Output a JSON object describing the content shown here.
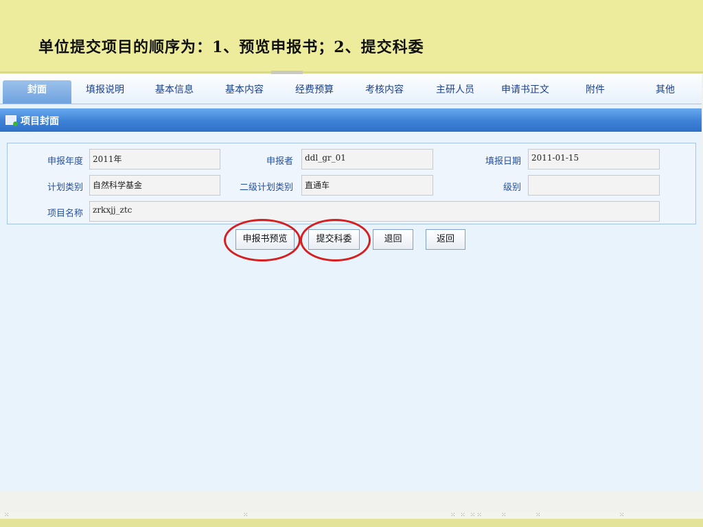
{
  "slide": {
    "title": "单位提交项目的顺序为：1、预览申报书；2、提交科委"
  },
  "tabs": [
    {
      "label": "封面",
      "active": true
    },
    {
      "label": "填报说明",
      "active": false
    },
    {
      "label": "基本信息",
      "active": false
    },
    {
      "label": "基本内容",
      "active": false
    },
    {
      "label": "经费预算",
      "active": false
    },
    {
      "label": "考核内容",
      "active": false
    },
    {
      "label": "主研人员",
      "active": false
    },
    {
      "label": "申请书正文",
      "active": false
    },
    {
      "label": "附件",
      "active": false
    },
    {
      "label": "其他",
      "active": false
    }
  ],
  "section": {
    "icon": "form-icon",
    "title": "项目封面"
  },
  "form": {
    "year": {
      "label": "申报年度",
      "value": "2011年"
    },
    "applicant": {
      "label": "申报者",
      "value": "ddl_gr_01"
    },
    "date": {
      "label": "填报日期",
      "value": "2011-01-15"
    },
    "plan_type": {
      "label": "计划类别",
      "value": "自然科学基金"
    },
    "sub_plan_type": {
      "label": "二级计划类别",
      "value": "直通车"
    },
    "level": {
      "label": "级别",
      "value": ""
    },
    "project_name": {
      "label": "项目名称",
      "value": "zrkxjj_ztc"
    }
  },
  "buttons": {
    "preview": "申报书预览",
    "submit": "提交科委",
    "return_back": "退回",
    "go_back": "返回"
  },
  "annotations": {
    "highlight_color": "#d42020",
    "highlighted": [
      "申报书预览",
      "提交科委"
    ]
  },
  "colors": {
    "header_bg": "#ecec9c",
    "section_bar": "#3d82d6",
    "label_text": "#2551a5"
  }
}
